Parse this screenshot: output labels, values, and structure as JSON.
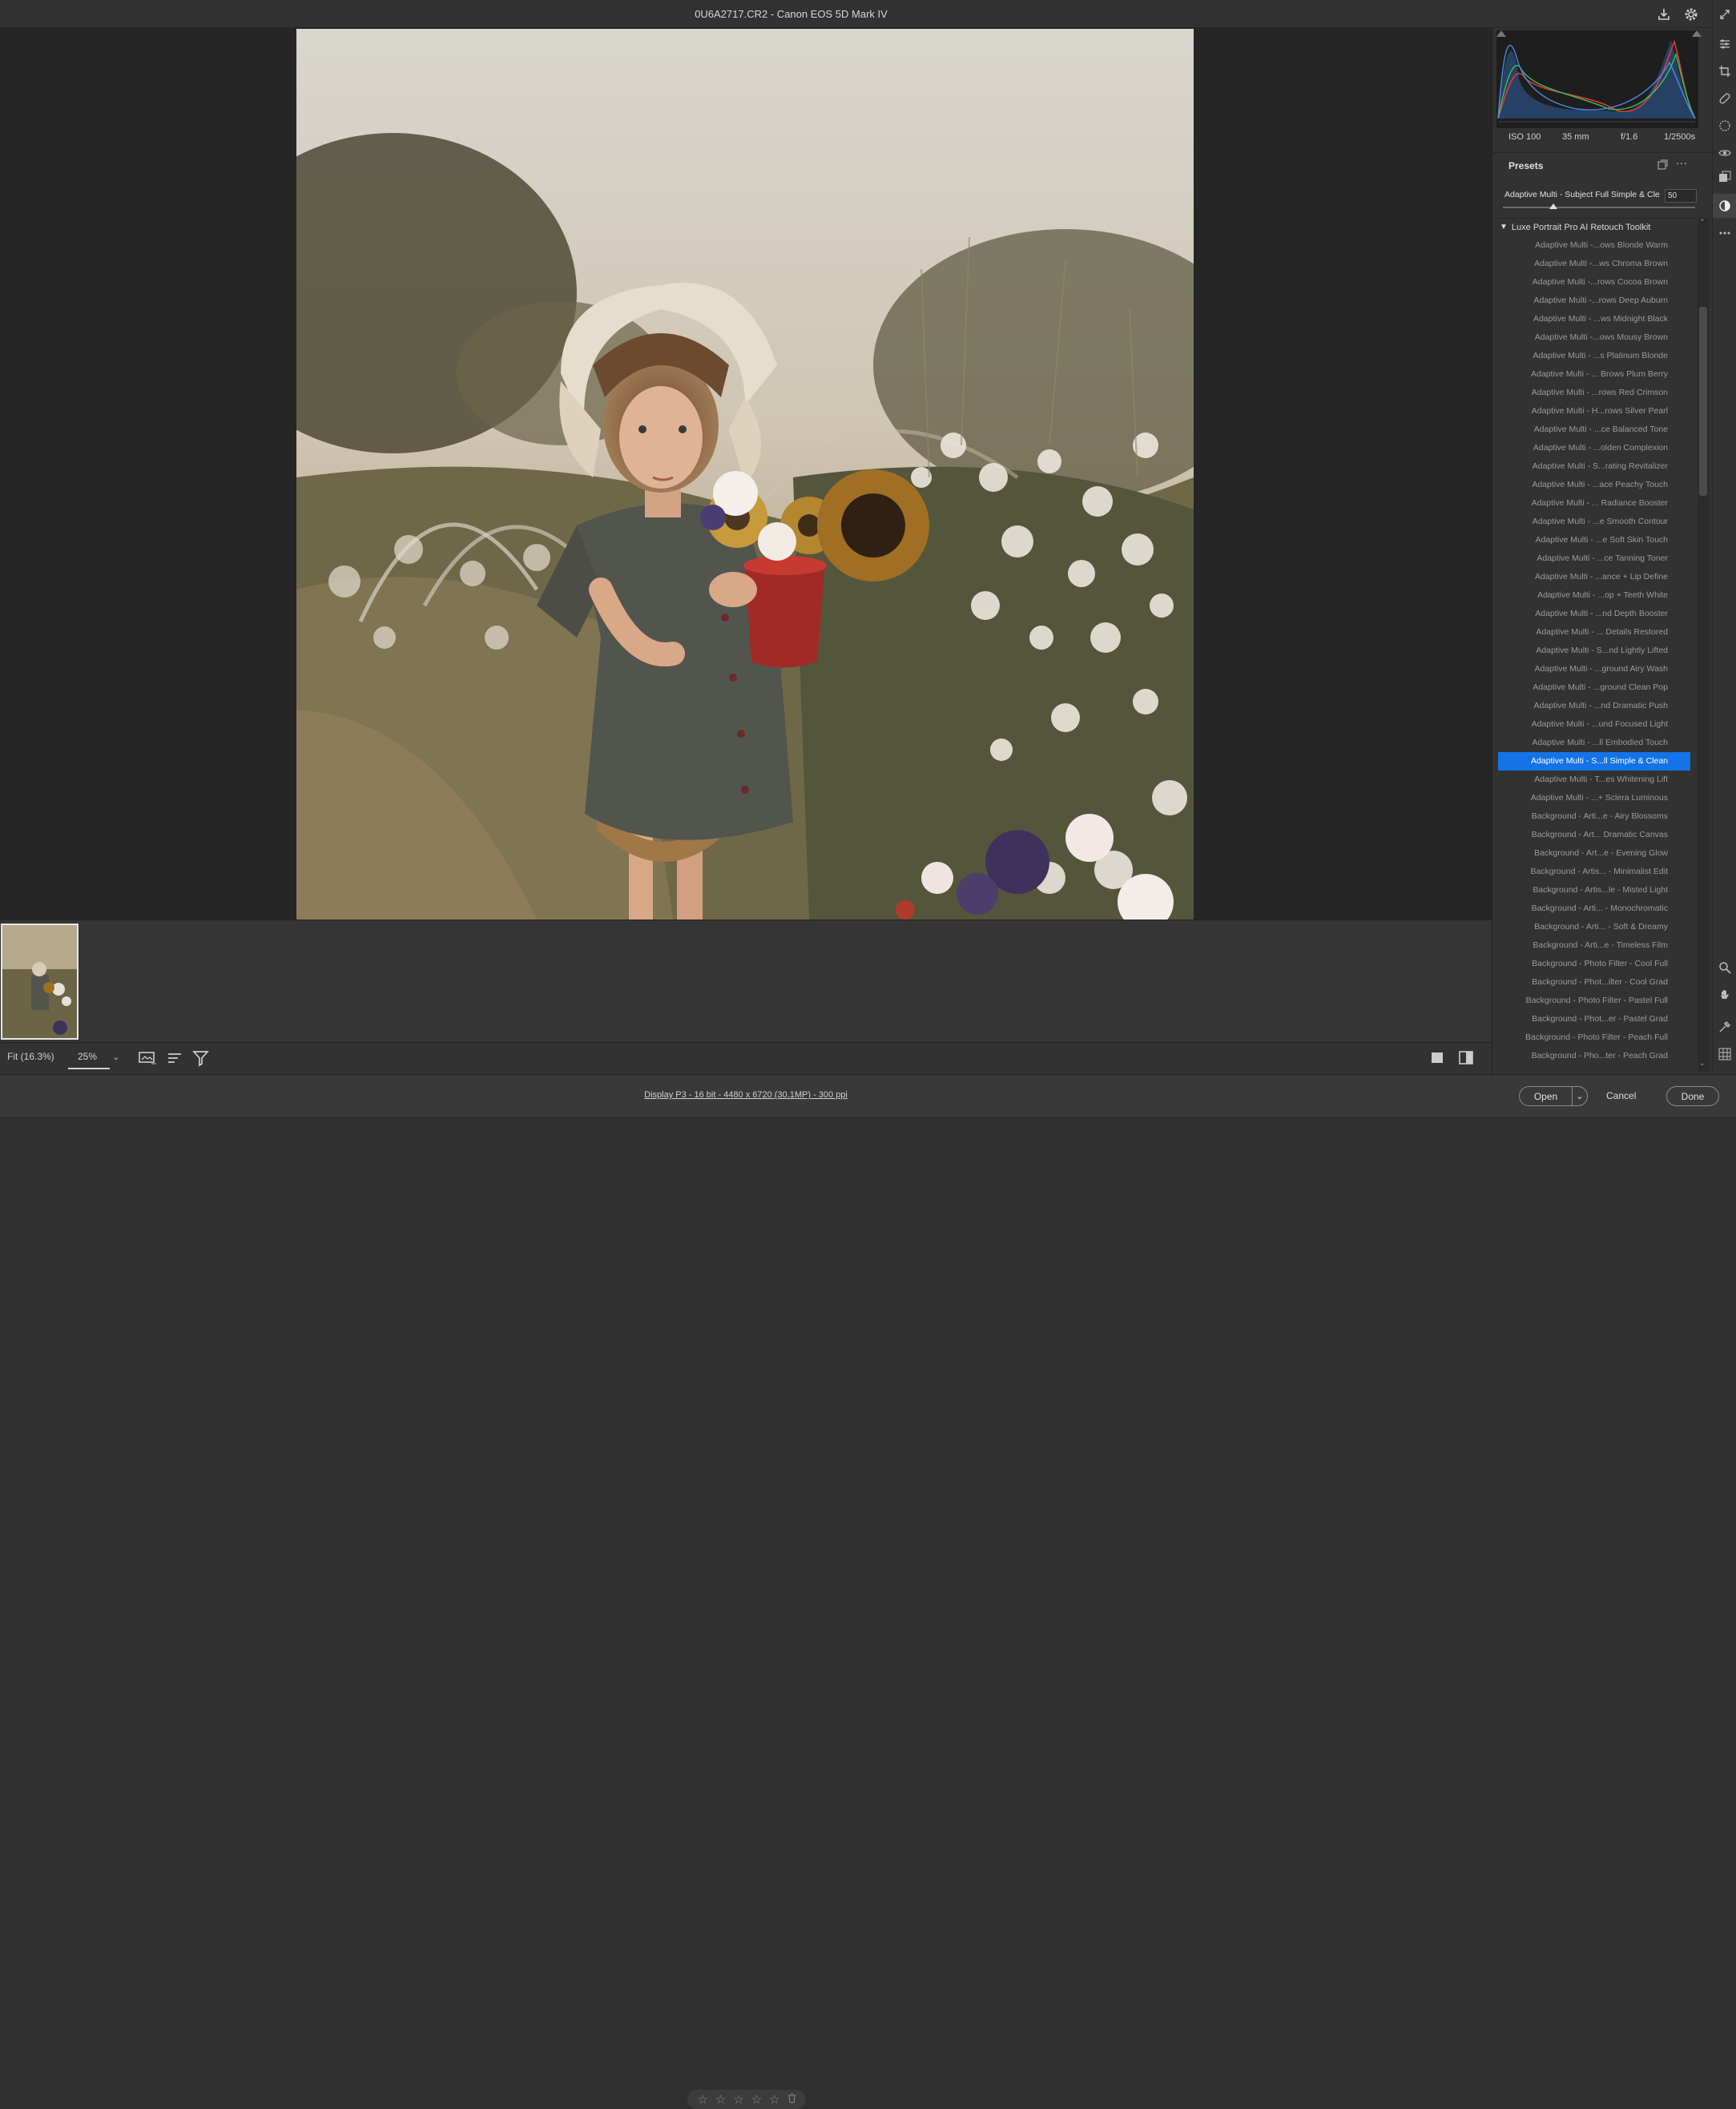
{
  "window": {
    "title": "0U6A2717.CR2  -  Canon EOS 5D Mark IV"
  },
  "exif": {
    "iso": "ISO 100",
    "focal": "35 mm",
    "aperture": "f/1.6",
    "shutter": "1/2500s"
  },
  "presets": {
    "header": "Presets",
    "selected_name": "Adaptive Multi - Subject Full Simple & Cle",
    "amount": "50",
    "group": "Luxe Portrait Pro AI Retouch Toolkit",
    "items": [
      "Adaptive Multi -...ows Blonde Warm",
      "Adaptive Multi -...ws Chroma Brown",
      "Adaptive Multi -...rows Cocoa Brown",
      "Adaptive Multi -...rows Deep Auburn",
      "Adaptive Multi - ...ws Midnight Black",
      "Adaptive Multi -...ows Mousy Brown",
      "Adaptive Multi - ...s Platinum Blonde",
      "Adaptive Multi - ... Brows Plum Berry",
      "Adaptive Multi - ...rows Red Crimson",
      "Adaptive Multi - H...rows Silver Pearl",
      "Adaptive Multi - ...ce Balanced Tone",
      "Adaptive Multi - ...olden Complexion",
      "Adaptive Multi - S...rating Revitalizer",
      "Adaptive Multi - ...ace Peachy Touch",
      "Adaptive Multi - ... Radiance Booster",
      "Adaptive Multi - ...e Smooth Contour",
      "Adaptive Multi - ...e Soft Skin Touch",
      "Adaptive Multi - ...ce Tanning Toner",
      "Adaptive Multi - ...ance + Lip Define",
      "Adaptive Multi - ...op + Teeth White",
      "Adaptive Multi - ...nd Depth Booster",
      "Adaptive Multi - ... Details Restored",
      "Adaptive Multi - S...nd Lightly Lifted",
      "Adaptive Multi - ...ground Airy Wash",
      "Adaptive Multi - ...ground Clean Pop",
      "Adaptive Multi - ...nd Dramatic Push",
      "Adaptive Multi - ...und Focused Light",
      "Adaptive Multi - ...ll Embodied Touch",
      "Adaptive Multi - S...ll Simple & Clean",
      "Adaptive Multi - T...es Whitening Lift",
      "Adaptive Multi - ...+ Sclera Luminous",
      "Background - Arti...e - Airy Blossoms",
      "Background - Art... Dramatic Canvas",
      "Background - Art...e - Evening Glow",
      "Background - Artis... - Minimalist Edit",
      "Background - Artis...le - Misted Light",
      "Background - Arti... - Monochromatic",
      "Background - Arti... - Soft & Dreamy",
      "Background - Arti...e - Timeless Film",
      "Background - Photo Filter - Cool Full",
      "Background - Phot...ilter - Cool Grad",
      "Background - Photo Filter - Pastel Full",
      "Background - Phot...er - Pastel Grad",
      "Background - Photo Filter - Peach Full",
      "Background - Pho...ter - Peach Grad"
    ],
    "selected_index": 28
  },
  "bottombar": {
    "fit": "Fit (16.3%)",
    "zoom": "25%"
  },
  "status": {
    "info": "Display P3 - 16 bit - 4480 x 6720 (30.1MP) - 300 ppi"
  },
  "buttons": {
    "open": "Open",
    "cancel": "Cancel",
    "done": "Done"
  },
  "colors": {
    "accent": "#1473e6"
  }
}
